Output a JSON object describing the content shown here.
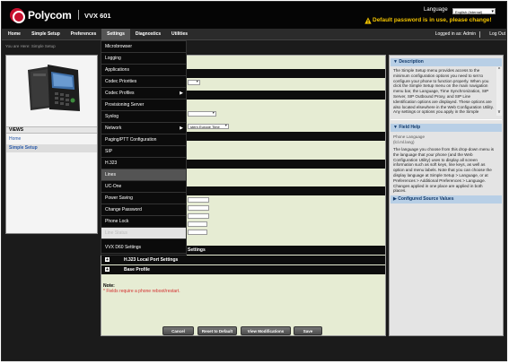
{
  "header": {
    "brand": "Polycom",
    "model": "VVX 601",
    "language_label": "Language",
    "language_value": "English (Internal)",
    "warning": "Default password is in use, please change!"
  },
  "nav": {
    "items": [
      "Home",
      "Simple Setup",
      "Preferences",
      "Settings",
      "Diagnostics",
      "Utilities"
    ],
    "logged_in": "Logged in as: Admin",
    "logout": "Log Out"
  },
  "breadcrumb": "You are Here: Simple Setup",
  "views": {
    "title": "VIEWS",
    "items": [
      "Home",
      "Simple Setup"
    ]
  },
  "settings_menu": {
    "items": [
      "Microbrowser",
      "Logging",
      "Applications",
      "Codec Priorities",
      "Codec Profiles",
      "Provisioning Server",
      "Syslog",
      "Network",
      "Paging/PTT Configuration",
      "SIP",
      "H.323",
      "Lines",
      "UC-One",
      "Power Saving",
      "Change Password",
      "Phone Lock",
      "Line Status",
      "VVX D60 Settings"
    ]
  },
  "main": {
    "timezone_value": "stern Europe Time",
    "partial_section": "Settings",
    "sections": [
      "H.323 Local Port Settings",
      "Base Profile"
    ],
    "note_label": "Note:",
    "note_text": "* Fields require a phone reboot/restart."
  },
  "buttons": [
    "Cancel",
    "Reset to Default",
    "View Modifications",
    "Save"
  ],
  "right_panel": {
    "description_title": "Description",
    "description_text": "The Simple Setup menu provides access to the minimum configuration options you need to set to configure your phone to function properly. When you click the Simple Setup menu on the main navigation menu bar, the Language, Time Synchronization, SIP Server, SIP Outbound Proxy, and SIP Line Identification options are displayed. These options are also located elsewhere in the Web Configuration Utility. Any settings or options you apply in the Simple",
    "field_help_title": "Field Help",
    "field_name": "Phone Language",
    "field_param": "(lcl.ml.lang)",
    "field_help_text": "The language you choose from this drop-down menu is the language that your phone (and the Web Configuration Utility) uses to display all screen information such as soft keys, line keys, as well as option and menu labels. Note that you can choose the display language at Simple Setup > Language, or at Preferences > Additional Preferences > Language. Changes applied in one place are applied in both places.",
    "config_title": "Configured Source Values"
  },
  "colors": {
    "header_bg": "#050505",
    "warning": "#f3c400",
    "main_bg": "#e6ecd3",
    "help_header": "#b8cfe6",
    "note_red": "#d32f2f",
    "brand_red": "#c8102e"
  }
}
